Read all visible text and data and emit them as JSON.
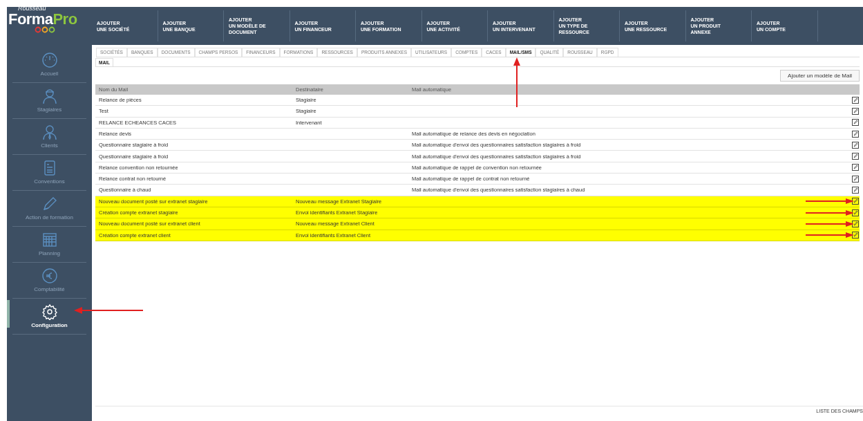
{
  "logo": {
    "brand_small": "Rousseau",
    "brand_main": "Forma",
    "brand_accent": "Pro"
  },
  "top_menu": [
    {
      "label": "AJOUTER\nUNE SOCIÉTÉ"
    },
    {
      "label": "AJOUTER\nUNE BANQUE"
    },
    {
      "label": "AJOUTER\nUN MODÈLE DE\nDOCUMENT"
    },
    {
      "label": "AJOUTER\nUN FINANCEUR"
    },
    {
      "label": "AJOUTER\nUNE FORMATION"
    },
    {
      "label": "AJOUTER\nUNE ACTIVITÉ"
    },
    {
      "label": "AJOUTER\nUN INTERVENANT"
    },
    {
      "label": "AJOUTER\nUN TYPE DE\nRESSOURCE"
    },
    {
      "label": "AJOUTER\nUNE RESSOURCE"
    },
    {
      "label": "AJOUTER\nUN PRODUIT\nANNEXE"
    },
    {
      "label": "AJOUTER\nUN COMPTE"
    }
  ],
  "sidebar": {
    "items": [
      {
        "label": "Accueil",
        "selected": false
      },
      {
        "label": "Stagiaires",
        "selected": false
      },
      {
        "label": "Clients",
        "selected": false
      },
      {
        "label": "Conventions",
        "selected": false
      },
      {
        "label": "Action de formation",
        "selected": false
      },
      {
        "label": "Planning",
        "selected": false
      },
      {
        "label": "Comptabilité",
        "selected": false
      },
      {
        "label": "Configuration",
        "selected": true
      }
    ]
  },
  "tabs": [
    {
      "label": "SOCIÉTÉS",
      "selected": false
    },
    {
      "label": "BANQUES",
      "selected": false
    },
    {
      "label": "DOCUMENTS",
      "selected": false
    },
    {
      "label": "CHAMPS PERSOS",
      "selected": false
    },
    {
      "label": "FINANCEURS",
      "selected": false
    },
    {
      "label": "FORMATIONS",
      "selected": false
    },
    {
      "label": "RESSOURCES",
      "selected": false
    },
    {
      "label": "PRODUITS ANNEXES",
      "selected": false
    },
    {
      "label": "UTILISATEURS",
      "selected": false
    },
    {
      "label": "COMPTES",
      "selected": false
    },
    {
      "label": "CACES",
      "selected": false
    },
    {
      "label": "MAIL/SMS",
      "selected": true
    },
    {
      "label": "QUALITÉ",
      "selected": false
    },
    {
      "label": "ROUSSEAU",
      "selected": false
    },
    {
      "label": "RGPD",
      "selected": false
    }
  ],
  "sub_tabs": [
    {
      "label": "MAIL",
      "selected": true
    }
  ],
  "add_button": "Ajouter un modèle de Mail",
  "table": {
    "columns": [
      "Nom du Mail",
      "Destinataire",
      "Mail automatique"
    ],
    "rows": [
      {
        "name": "Relance de pièces",
        "recipient": "Stagiaire",
        "auto": "",
        "highlighted": false
      },
      {
        "name": "Test",
        "recipient": "Stagiaire",
        "auto": "",
        "highlighted": false
      },
      {
        "name": "RELANCE ECHEANCES CACES",
        "recipient": "Intervenant",
        "auto": "",
        "highlighted": false
      },
      {
        "name": "Relance devis",
        "recipient": "",
        "auto": "Mail automatique de relance des devis en négociation",
        "highlighted": false
      },
      {
        "name": "Questionnaire stagiaire à froid",
        "recipient": "",
        "auto": "Mail automatique d'envoi des questionnaires satisfaction stagiaires à froid",
        "highlighted": false
      },
      {
        "name": "Questionnaire stagiaire à froid",
        "recipient": "",
        "auto": "Mail automatique d'envoi des questionnaires satisfaction stagiaires à froid",
        "highlighted": false
      },
      {
        "name": "Relance convention non retournée",
        "recipient": "",
        "auto": "Mail automatique de rappel de convention non retournée",
        "highlighted": false
      },
      {
        "name": "Relance contrat non retourné",
        "recipient": "",
        "auto": "Mail automatique de rappel de contrat non retourné",
        "highlighted": false
      },
      {
        "name": "Questionnaire à chaud",
        "recipient": "",
        "auto": "Mail automatique d'envoi des questionnaires satisfaction stagiaires à chaud",
        "highlighted": false
      },
      {
        "name": "Nouveau document posté sur extranet stagiaire",
        "recipient": "Nouveau message Extranet Stagiaire",
        "auto": "",
        "highlighted": true
      },
      {
        "name": "Création compte extranet stagiaire",
        "recipient": "Envoi identifiants Extranet Stagiaire",
        "auto": "",
        "highlighted": true
      },
      {
        "name": "Nouveau document posté sur extranet client",
        "recipient": "Nouveau message Extranet Client",
        "auto": "",
        "highlighted": true
      },
      {
        "name": "Création compte extranet client",
        "recipient": "Envoi identifiants Extranet Client",
        "auto": "",
        "highlighted": true
      }
    ]
  },
  "footer_link": "LISTE DES CHAMPS"
}
